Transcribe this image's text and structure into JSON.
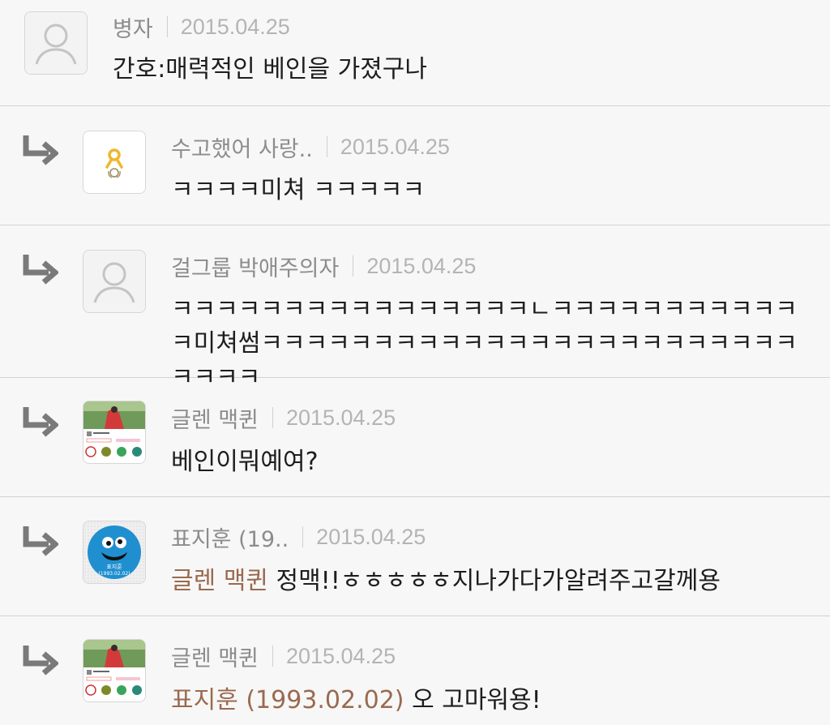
{
  "comments": [
    {
      "author": "병자",
      "date": "2015.04.25",
      "text": "간호:매력적인 베인을 가졌구나",
      "avatar_icon": "default-person-icon"
    },
    {
      "author": "수고했어 사랑..",
      "date": "2015.04.25",
      "text": "ㅋㅋㅋㅋ미쳐 ㅋㅋㅋㅋㅋ",
      "avatar_icon": "yellow-ribbon-icon"
    },
    {
      "author": "걸그룹 박애주의자",
      "date": "2015.04.25",
      "text": "ㅋㅋㅋㅋㅋㅋㅋㅋㅋㅋㅋㅋㅋㅋㅋㅋㄴㅋㅋㅋㅋㅋㅋㅋㅋㅋㅋㅋㅋ미쳐썸ㅋㅋㅋㅋㅋㅋㅋㅋㅋㅋㅋㅋㅋㅋㅋㅋㅋㅋㅋㅋㅋㅋㅋㅋㅋㅋㅋㅋ",
      "avatar_icon": "default-person-icon"
    },
    {
      "author": "글렌 맥퀸",
      "date": "2015.04.25",
      "text": "베인이뭐예여?",
      "avatar_icon": "profile-photo-icon"
    },
    {
      "author": "표지훈 (19..",
      "date": "2015.04.25",
      "mention": "글렌 맥퀸",
      "text": "정맥!!ㅎㅎㅎㅎㅎ지나가다가알려주고갈께용",
      "avatar_icon": "cookie-monster-badge-icon",
      "avatar_caption_name": "표지훈",
      "avatar_caption_date": "(1993.02.02)"
    },
    {
      "author": "글렌 맥퀸",
      "date": "2015.04.25",
      "mention": "표지훈 (1993.02.02)",
      "text": "오 고마워용!",
      "avatar_icon": "profile-photo-icon"
    }
  ],
  "colors": {
    "background": "#f7f7f7",
    "author": "#8c8c8c",
    "date": "#b4b4b4",
    "mention": "#9a6a4f",
    "divider": "#d2d2d2"
  }
}
